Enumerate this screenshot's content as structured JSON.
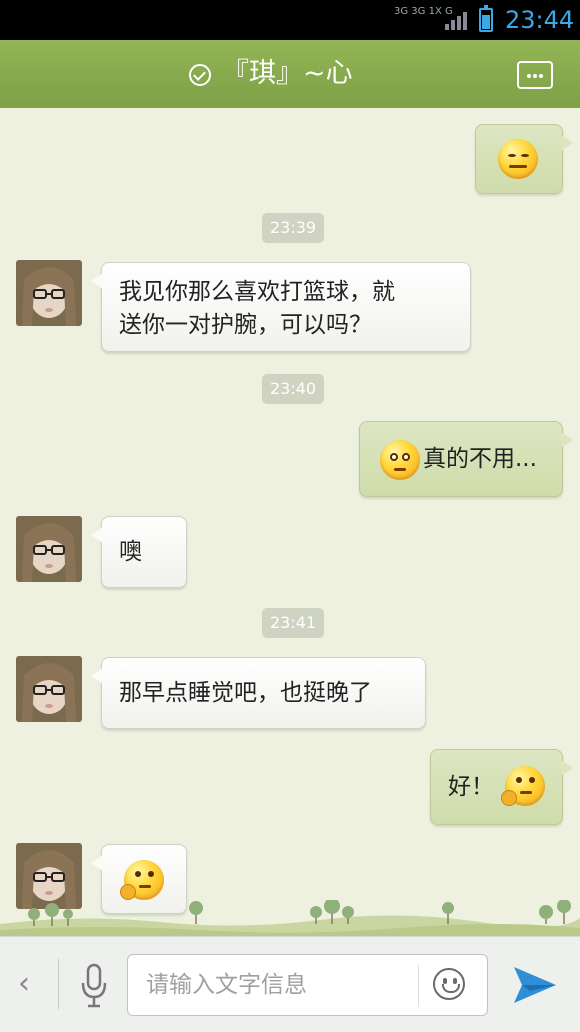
{
  "status_bar": {
    "network": "3G 3G 1X G",
    "time": "23:44"
  },
  "header": {
    "title": "『琪』~心",
    "more_icon": "more-dots-icon",
    "verified_icon": "check-circle-icon"
  },
  "messages": [
    {
      "type": "out",
      "kind": "emoji",
      "emoji": "annoyed-face-emoji"
    },
    {
      "type": "time",
      "text": "23:39"
    },
    {
      "type": "in",
      "text_line1": "我见你那么喜欢打篮球，就",
      "text_line2": "送你一对护腕，可以吗？"
    },
    {
      "type": "time",
      "text": "23:40"
    },
    {
      "type": "out",
      "text": "真的不用...",
      "emoji": "squint-face-emoji"
    },
    {
      "type": "in",
      "text": "噢"
    },
    {
      "type": "time",
      "text": "23:41"
    },
    {
      "type": "in",
      "text": "那早点睡觉吧，也挺晚了"
    },
    {
      "type": "out",
      "text": "好！",
      "emoji": "thinking-face-emoji"
    },
    {
      "type": "in",
      "kind": "emoji",
      "emoji": "thinking-face-emoji"
    }
  ],
  "input": {
    "placeholder": "请输入文字信息",
    "value": ""
  },
  "colors": {
    "header_bg": "#8aac4f",
    "chat_bg": "#eef1df",
    "outgoing_bubble": "#d6e1b6",
    "incoming_bubble": "#ffffff",
    "clock": "#3aa9e6",
    "send": "#2f8fd6"
  }
}
